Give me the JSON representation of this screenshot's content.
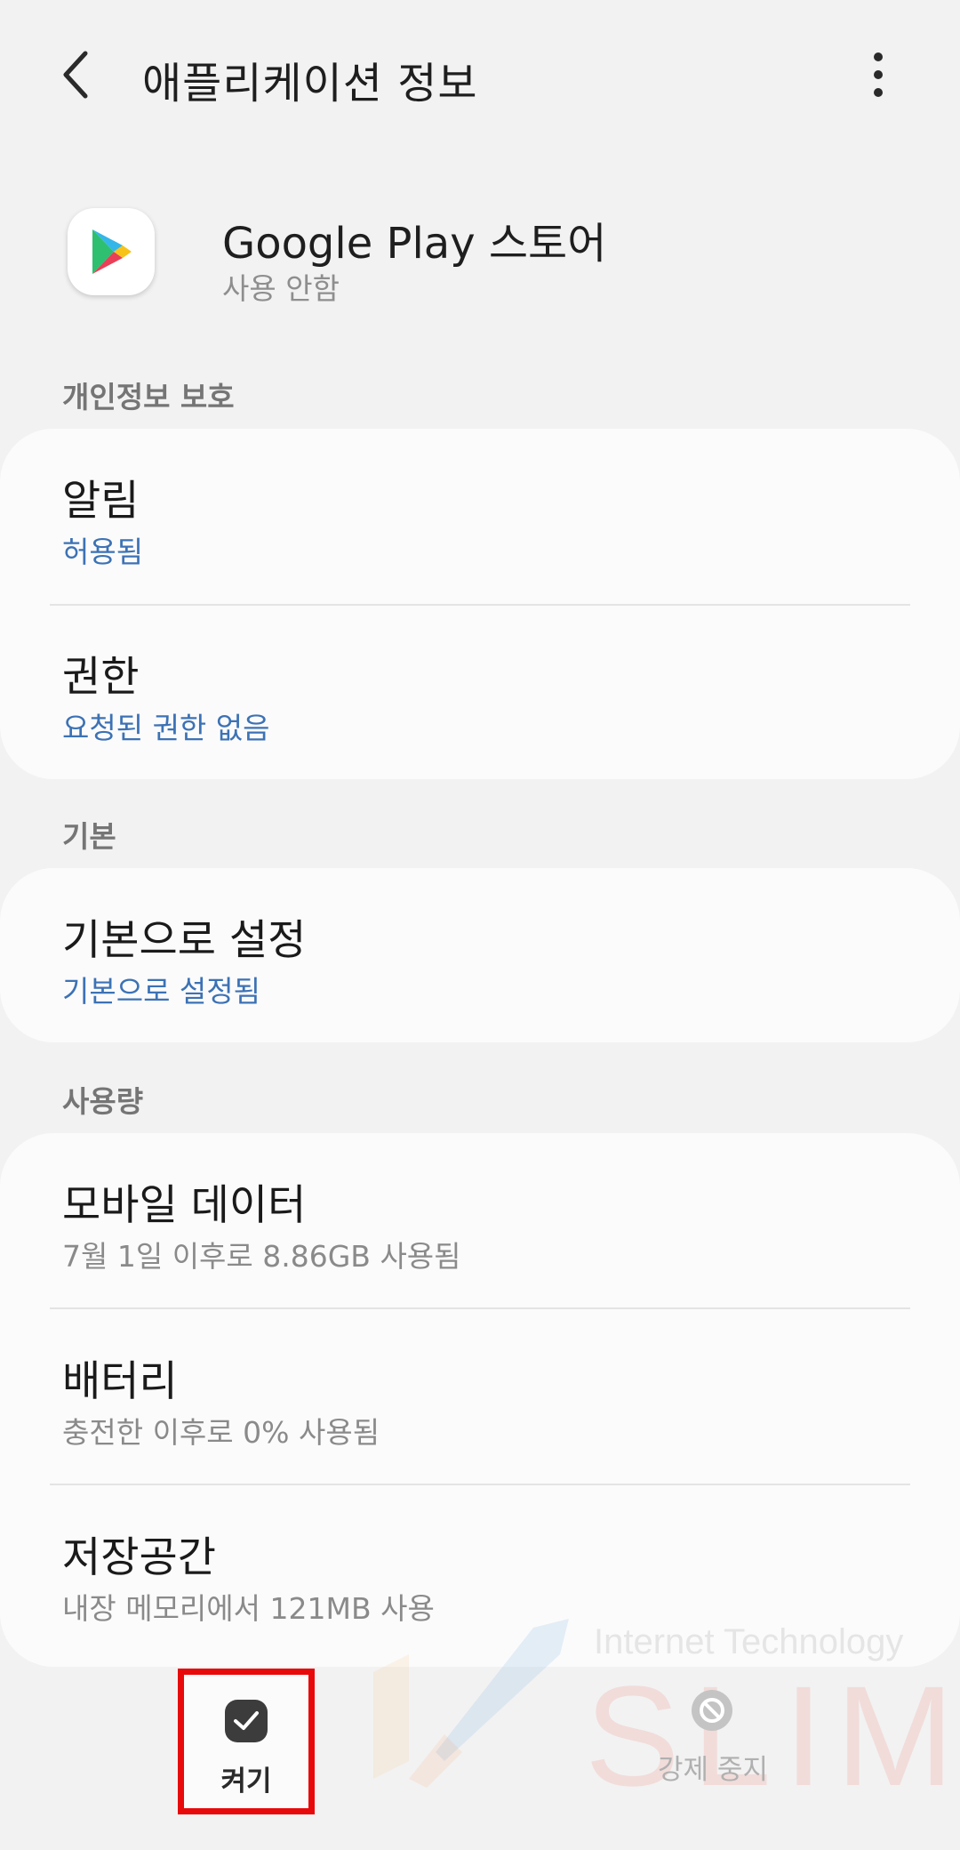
{
  "header": {
    "title": "애플리케이션 정보",
    "back_icon": "chevron-left-icon",
    "more_icon": "more-vert-icon"
  },
  "app": {
    "name": "Google Play 스토어",
    "status": "사용 안함",
    "icon": "google-play-icon"
  },
  "sections": {
    "privacy": {
      "header": "개인정보 보호",
      "items": [
        {
          "title": "알림",
          "subtitle": "허용됨"
        },
        {
          "title": "권한",
          "subtitle": "요청된 권한 없음"
        }
      ]
    },
    "defaults": {
      "header": "기본",
      "items": [
        {
          "title": "기본으로 설정",
          "subtitle": "기본으로 설정됨"
        }
      ]
    },
    "usage": {
      "header": "사용량",
      "items": [
        {
          "title": "모바일 데이터",
          "subtitle": "7월 1일 이후로 8.86GB 사용됨"
        },
        {
          "title": "배터리",
          "subtitle": "충전한 이후로 0% 사용됨"
        },
        {
          "title": "저장공간",
          "subtitle": "내장 메모리에서 121MB 사용"
        }
      ]
    }
  },
  "bottom": {
    "enable_label": "켜기",
    "enable_icon": "check-icon",
    "force_stop_label": "강제 중지",
    "force_stop_icon": "block-icon"
  },
  "watermark": {
    "line1": "Internet Technology",
    "line2": "SLIM"
  },
  "colors": {
    "background": "#f2f2f2",
    "card": "#fbfbfb",
    "link_blue": "#3c72b5",
    "highlight_red": "#e8090b"
  }
}
